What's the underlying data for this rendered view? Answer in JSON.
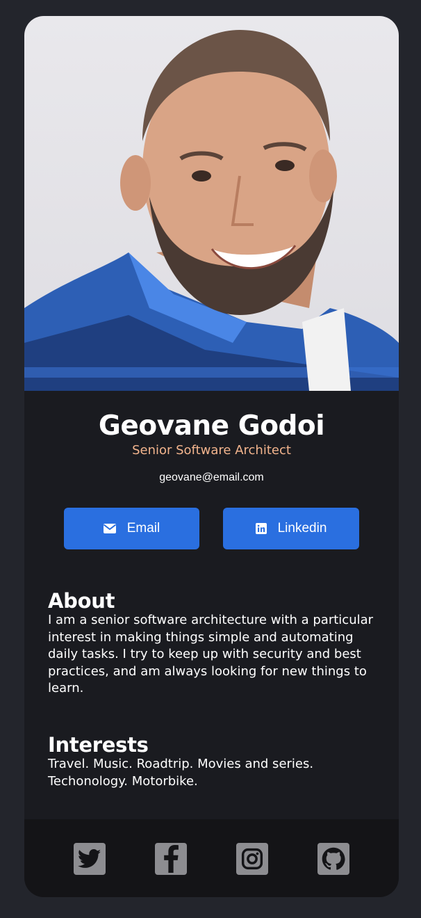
{
  "profile": {
    "photo_alt": "Geovane Godoi",
    "name": "Geovane Godoi",
    "title": "Senior Software Architect",
    "email": "geovane@email.com"
  },
  "buttons": {
    "email_label": "Email",
    "email_icon": "envelope-icon",
    "linkedin_label": "Linkedin",
    "linkedin_icon": "linkedin-icon",
    "color": "#2a6fe0"
  },
  "about": {
    "heading": "About",
    "text": "I am a senior software architecture with a particular interest in making things simple and automating daily tasks. I try to keep up with security and best practices, and am always looking for new things to learn."
  },
  "interests": {
    "heading": "Interests",
    "text": "Travel. Music. Roadtrip. Movies and series. Techonology. Motorbike."
  },
  "footer": {
    "icons": [
      "twitter-icon",
      "facebook-icon",
      "instagram-icon",
      "github-icon"
    ]
  },
  "colors": {
    "background": "#23252c",
    "card": "#1a1b20",
    "footer": "#141417",
    "title_accent": "#f2b48d"
  }
}
